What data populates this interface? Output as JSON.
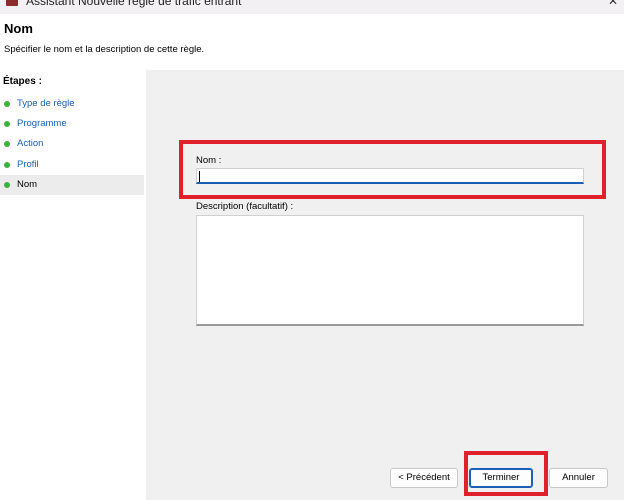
{
  "window": {
    "title": "Assistant Nouvelle règle de trafic entrant",
    "close_glyph": "✕"
  },
  "header": {
    "heading": "Nom",
    "subheading": "Spécifier le nom et la description de cette règle."
  },
  "steps": {
    "title": "Étapes :",
    "items": [
      {
        "label": "Type de règle"
      },
      {
        "label": "Programme"
      },
      {
        "label": "Action"
      },
      {
        "label": "Profil"
      },
      {
        "label": "Nom"
      }
    ],
    "current_index": 4
  },
  "form": {
    "name_label": "Nom :",
    "name_value": "",
    "description_label": "Description (facultatif) :",
    "description_value": ""
  },
  "buttons": {
    "previous": "< Précédent",
    "finish": "Terminer",
    "cancel": "Annuler"
  },
  "colors": {
    "step_dot": "#3bb33b",
    "link": "#1a5fb4",
    "highlight": "#e0202a"
  }
}
